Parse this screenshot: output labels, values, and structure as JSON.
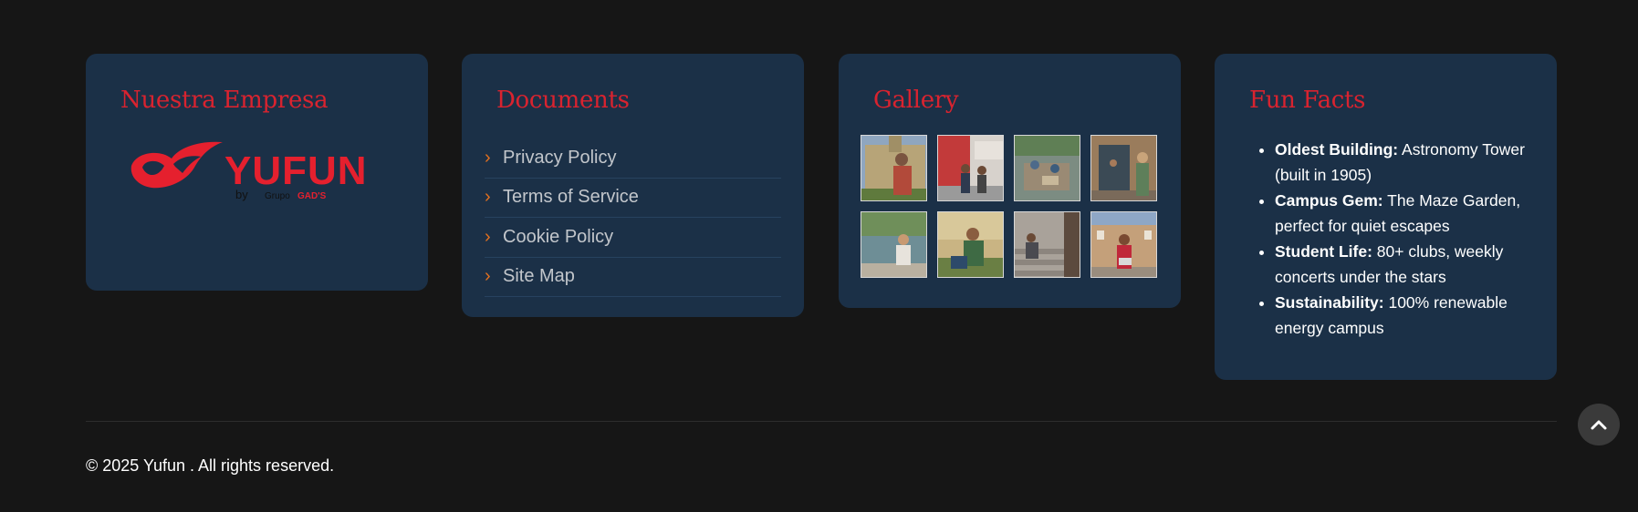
{
  "company": {
    "title": "Nuestra Empresa",
    "logo_text": "YUFUN",
    "logo_byline_by": "by",
    "logo_byline_group": "Grupo",
    "logo_byline_brand": "GAD'S"
  },
  "documents": {
    "title": "Documents",
    "chevron": "›",
    "items": [
      {
        "label": "Privacy Policy"
      },
      {
        "label": "Terms of Service"
      },
      {
        "label": "Cookie Policy"
      },
      {
        "label": "Site Map"
      }
    ]
  },
  "gallery": {
    "title": "Gallery",
    "images": [
      {
        "icon": "photo-student-building"
      },
      {
        "icon": "photo-students-red-building"
      },
      {
        "icon": "photo-students-courtyard"
      },
      {
        "icon": "photo-students-doorway"
      },
      {
        "icon": "photo-student-lake"
      },
      {
        "icon": "photo-student-reading"
      },
      {
        "icon": "photo-student-stairs"
      },
      {
        "icon": "photo-student-laptop"
      }
    ]
  },
  "facts": {
    "title": "Fun Facts",
    "items": [
      {
        "label": "Oldest Building:",
        "text": " Astronomy Tower (built in 1905)"
      },
      {
        "label": "Campus Gem:",
        "text": " The Maze Garden, perfect for quiet escapes"
      },
      {
        "label": "Student Life:",
        "text": " 80+ clubs, weekly concerts under the stars"
      },
      {
        "label": "Sustainability:",
        "text": " 100% renewable energy campus"
      }
    ]
  },
  "footer": {
    "copyright": "© 2025 Yufun . All rights reserved.",
    "back_to_top_icon": "chevron-up-icon"
  },
  "colors": {
    "background": "#161616",
    "card": "#1b3047",
    "accent_red": "#d9232f",
    "chevron_orange": "#e2701f"
  }
}
